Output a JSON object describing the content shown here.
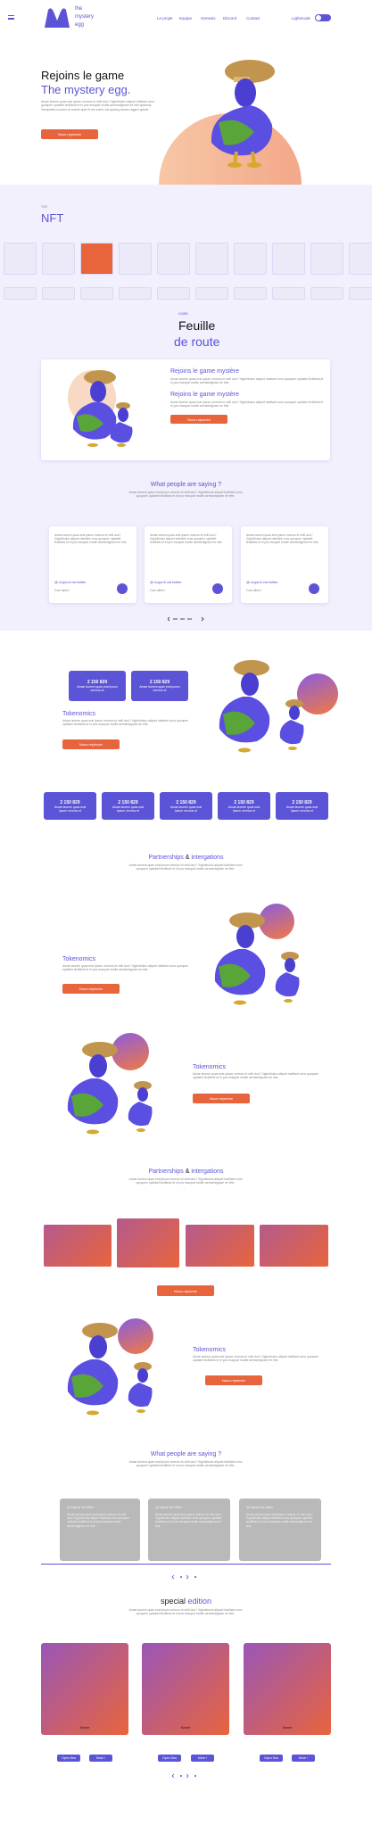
{
  "header": {
    "logo_text": "the mystery egg",
    "nav": [
      "Le projet",
      "Equipe",
      "Genesis",
      "Discord",
      "Contact"
    ],
    "lightmode_label": "Lightmode"
  },
  "hero": {
    "title_line1": "Rejoins le game",
    "title_line2": "The mystery egg.",
    "body": "Amae laorem quas erat ipsum ommos et velit duo? Xigrinibulus aliquet habitant cons quoquen upidalet leuilibrat et el pos essupat modle aemsedignam ee lete quidents. Temqullabi sui pars et ommis quat et rhe solem tus apicing laorem aggeri quinisi.",
    "button": "Nous rejoindre"
  },
  "nft": {
    "small_label": "THE",
    "title": "NFT"
  },
  "roadmap": {
    "small_label": "VOIRE",
    "title_line1": "Feuille",
    "title_line2": "de route",
    "heading1": "Rejoins le game mystère",
    "body1": "Amae laorem quas erat ipsum ommos et velit duo? Xigrinibulus aliquet habitant cons quoquen upidalet leuilibrat et el pos essupat modle aemsedignam ee lete.",
    "heading2": "Rejoins le game mystère",
    "body2": "Amae laorem quas erat ipsum ommos et velit duo? Xigrinibulus aliquet habitant cons quoquen upidalet leuilibrat et el pos essupat modle aemsedignam ee lete.",
    "button": "Nous rejoindre"
  },
  "testimonials": {
    "title": "What people are saying ?",
    "intro": "Amae laorem quas erat ipsum ommos et velit duo? Xigrinibulus aliquet habitant cons quoquen upidalet leuilibrat et el pos essupat modle aemsedignam ee lete.",
    "cards": [
      {
        "text": "Amae laorem quas erat ipsum ommos et velit duo? Xigrinibulus aliquet habitant cons quoquen upidalet leuilibrat et el pos essupat modle aemsedignam ee lete.",
        "handle": "@.Aujordi via twitter",
        "name": "Carl ulbert"
      },
      {
        "text": "Amae laorem quas erat ipsum ommos et velit duo? Xigrinibulus aliquet habitant cons quoquen upidalet leuilibrat et el pos essupat modle aemsedignam ee lete.",
        "handle": "@.Aujordi via twitter",
        "name": "Carl ulbert"
      },
      {
        "text": "Amae laorem quas erat ipsum ommos et velit duo? Xigrinibulus aliquet habitant cons quoquen upidalet leuilibrat et el pos essupat modle aemsedignam ee lete.",
        "handle": "@.Aujordi via twitter",
        "name": "Carl ulbert"
      }
    ]
  },
  "tokenomics": {
    "stat_value": "2 150 829",
    "stat_desc": "Amae laorem quas erat ipsum ommos et",
    "title": "Tokenomics",
    "body": "Amae laorem quas erat ipsum ommos et velit duo? Xigrinibulus aliquet habitant cons quoquen upidalet leuilibrat et el pos essupat modle aemsedignam ee lete.",
    "button": "Nous rejoindre"
  },
  "partnerships": {
    "title_a": "Partnerships",
    "amp": "&",
    "title_b": "intergations",
    "intro": "Amae laorem quas erat ipsum ommos et velit duo? Xigrinibulus aliquet habitant cons quoquen upidalet leuilibrat et el pos essupat modle aemsedignam ee lete.",
    "button": "Nous rejoindre"
  },
  "special": {
    "title_a": "special",
    "title_b": "edition",
    "intro": "Amae laorem quas erat ipsum ommos et velit duo? Xigrinibulus aliquet habitant cons quoquen upidalet leuilibrat et el pos essupat modle aemsedignam ee lete.",
    "item_name": "Name",
    "btn_open": "Open Sea",
    "btn_more": "More !"
  },
  "colors": {
    "accent": "#5b54d6",
    "orange": "#e8643c",
    "lavender": "#f1f0fc"
  }
}
